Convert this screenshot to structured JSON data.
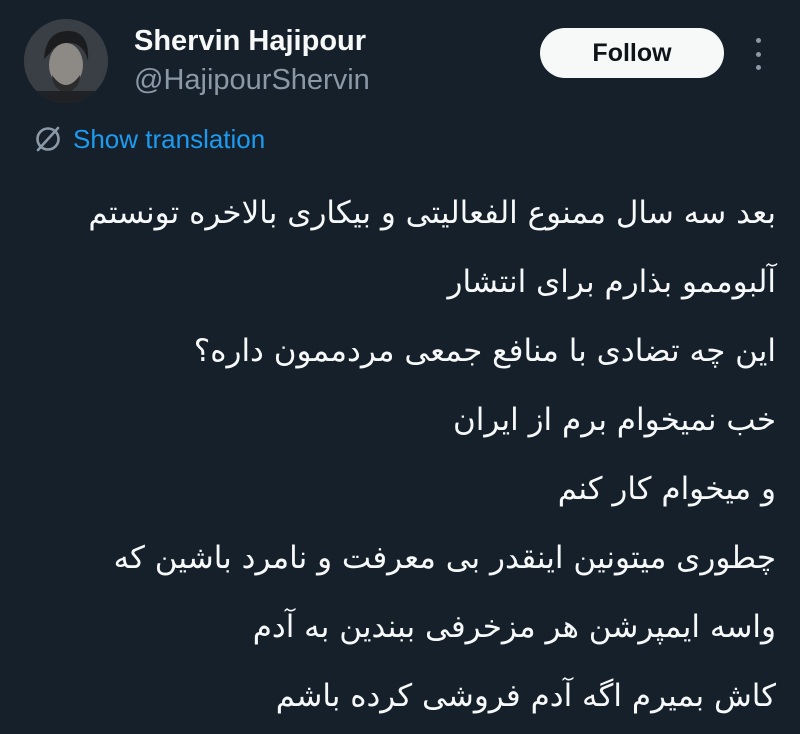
{
  "author": {
    "display_name": "Shervin Hajipour",
    "handle": "@HajipourShervin"
  },
  "actions": {
    "follow_label": "Follow",
    "more_icon": "more-vertical-icon"
  },
  "translation": {
    "icon": "translate-globe-icon",
    "label": "Show translation"
  },
  "tweet": {
    "lines": [
      "بعد سه سال ممنوع الفعالیتی و بیکاری بالاخره تونستم",
      "آلبوممو بذارم برای انتشار",
      "این چه تضادی با منافع جمعی مردممون داره؟",
      "خب نمیخوام برم از ایران",
      "و میخوام کار کنم",
      "چطوری میتونین اینقدر بی معرفت و نامرد باشین که",
      "واسه ایمپرشن هر مزخرفی ببندین به آدم",
      "کاش بمیرم اگه آدم فروشی کرده باشم"
    ]
  },
  "colors": {
    "background": "#15202b",
    "text_primary": "#f7f9f9",
    "text_secondary": "#8b98a5",
    "link": "#1d9bf0",
    "follow_button_bg": "#f7f9f9",
    "follow_button_text": "#0f1419"
  }
}
